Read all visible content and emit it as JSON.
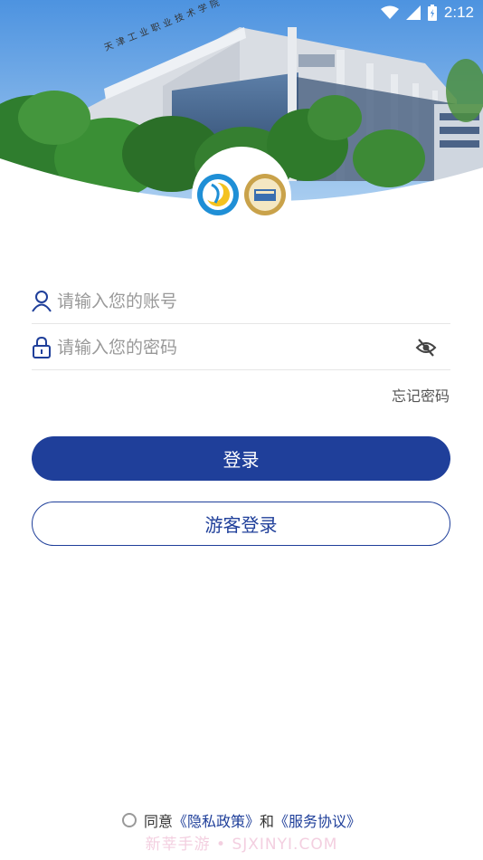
{
  "status_bar": {
    "time": "2:12",
    "icons": [
      "wifi-icon",
      "signal-icon",
      "battery-icon"
    ]
  },
  "header": {
    "building_sign": "天津工业职业技术学院",
    "photo": "campus-building-photo"
  },
  "logos": [
    "gear-moon-logo",
    "college-seal-logo"
  ],
  "login_form": {
    "account_placeholder": "请输入您的账号",
    "account_value": "",
    "password_placeholder": "请输入您的密码",
    "password_value": "",
    "forgot_label": "忘记密码",
    "login_label": "登录",
    "guest_label": "游客登录"
  },
  "agreement": {
    "prefix": "同意",
    "privacy_label": "《隐私政策》",
    "conjunction": "和",
    "terms_label": "《服务协议》",
    "checked": false
  },
  "watermark": "新莘手游 • SJXINYI.COM",
  "colors": {
    "primary": "#1f3f9a",
    "sky": "#6aa9e6",
    "tree": "#2e7d32"
  }
}
